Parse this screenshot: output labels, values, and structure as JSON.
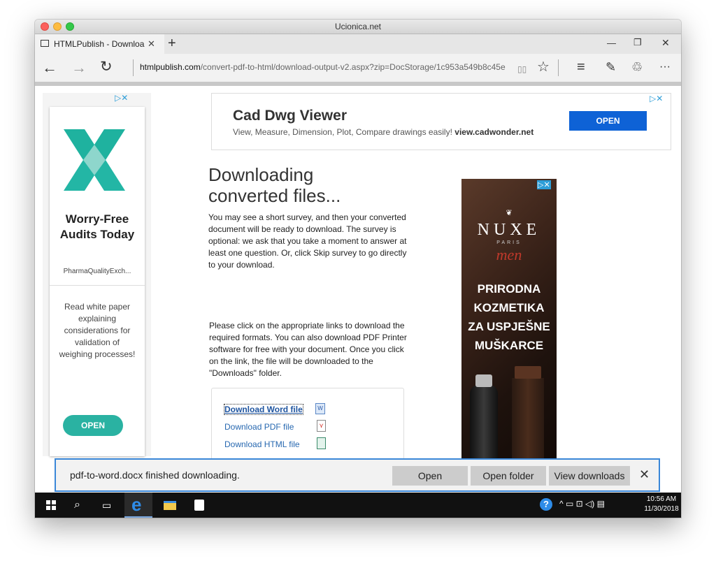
{
  "window": {
    "title": "Ucionica.net"
  },
  "tab": {
    "title": "HTMLPublish - Downloa",
    "close": "✕",
    "new_tab": "+"
  },
  "window_controls": {
    "minimize": "—",
    "restore": "❐",
    "close": "✕"
  },
  "address": {
    "domain": "htmlpublish.com",
    "path": "/convert-pdf-to-html/download-output-v2.aspx?zip=DocStorage/1c953a549b8c45e"
  },
  "nav_icons": {
    "back": "←",
    "forward": "→",
    "refresh": "↻",
    "reading": "▯▯",
    "favorite": "☆",
    "hub": "≡",
    "notes": "✎",
    "share": "♲",
    "more": "···"
  },
  "ad_choice": "▷✕",
  "left_ad": {
    "headline": "Worry-Free Audits Today",
    "source": "PharmaQualityExch...",
    "body": "Read white paper explaining considerations for validation of weighing processes!",
    "button": "OPEN"
  },
  "top_ad": {
    "title": "Cad Dwg Viewer",
    "description": "View, Measure, Dimension, Plot, Compare drawings easily!",
    "site": "view.cadwonder.net",
    "button": "OPEN"
  },
  "main": {
    "heading": "Downloading converted files...",
    "intro": "You may see a short survey, and then your converted document will be ready to download. The survey is optional: we ask that you take a moment to answer at least one question. Or, click Skip survey to go directly to your download.",
    "instructions": "Please click on the appropriate links to download the required formats. You can also download PDF Printer software for free with your document. Once you click on the link, the file will be downloaded to the \"Downloads\" folder.",
    "links": [
      "Download Word file",
      "Download PDF file",
      "Download HTML file"
    ]
  },
  "right_ad": {
    "brand": "NUXE",
    "brand_sub": "PARIS",
    "brand_line": "men",
    "text": "PRIRODNA KOZMETIKA ZA USPJEŠNE MUŠKARCE",
    "bottle_label": "NUXE men"
  },
  "download_bar": {
    "message": "pdf-to-word.docx finished downloading.",
    "open": "Open",
    "open_folder": "Open folder",
    "view_downloads": "View downloads",
    "close": "✕"
  },
  "taskbar": {
    "time": "10:56 AM",
    "date": "11/30/2018",
    "tray": "^ ▭ ⊡ ◁) ▤"
  },
  "colors": {
    "accent_blue": "#0e62d6",
    "teal": "#2ab2a2",
    "link": "#2768b0",
    "notif_border": "#3a87d8"
  }
}
